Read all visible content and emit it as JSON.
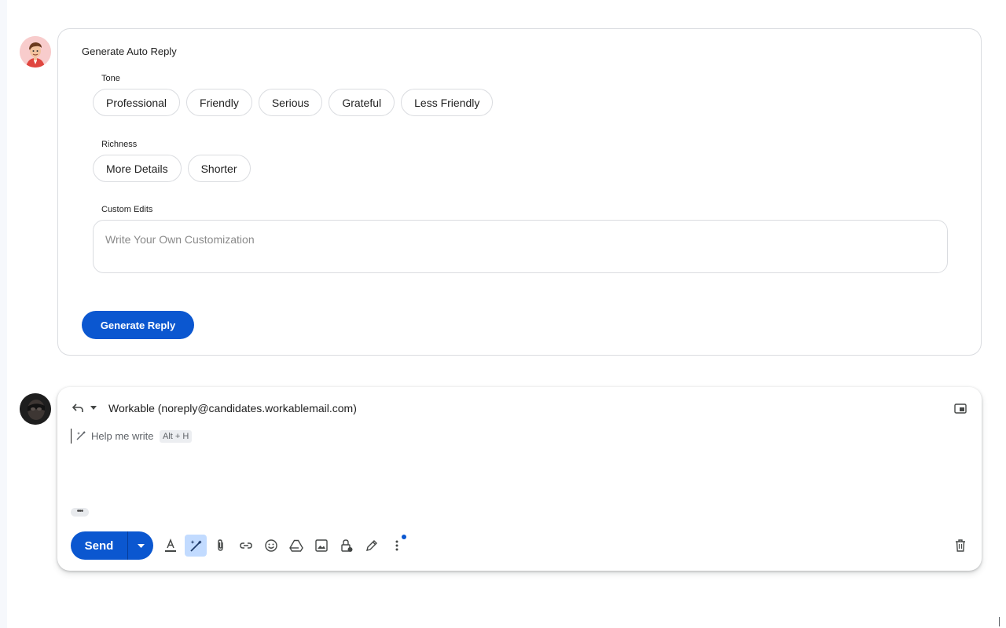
{
  "auto_reply": {
    "title": "Generate Auto Reply",
    "tone_label": "Tone",
    "tone_options": [
      "Professional",
      "Friendly",
      "Serious",
      "Grateful",
      "Less Friendly"
    ],
    "richness_label": "Richness",
    "richness_options": [
      "More Details",
      "Shorter"
    ],
    "custom_label": "Custom Edits",
    "custom_placeholder": "Write Your Own Customization",
    "generate_button": "Generate Reply"
  },
  "compose": {
    "recipient": "Workable (noreply@candidates.workablemail.com)",
    "help_me_write": "Help me write",
    "help_shortcut": "Alt + H",
    "expand_dots": "•••",
    "send_label": "Send",
    "toolbar_icons": [
      "formatting-icon",
      "help-me-write-icon",
      "attach-icon",
      "link-icon",
      "emoji-icon",
      "drive-icon",
      "photo-icon",
      "confidential-icon",
      "signature-icon",
      "more-options-icon"
    ]
  },
  "colors": {
    "primary": "#0b57d0",
    "active_icon_bg": "#c2dbff",
    "border": "#dadce0"
  }
}
